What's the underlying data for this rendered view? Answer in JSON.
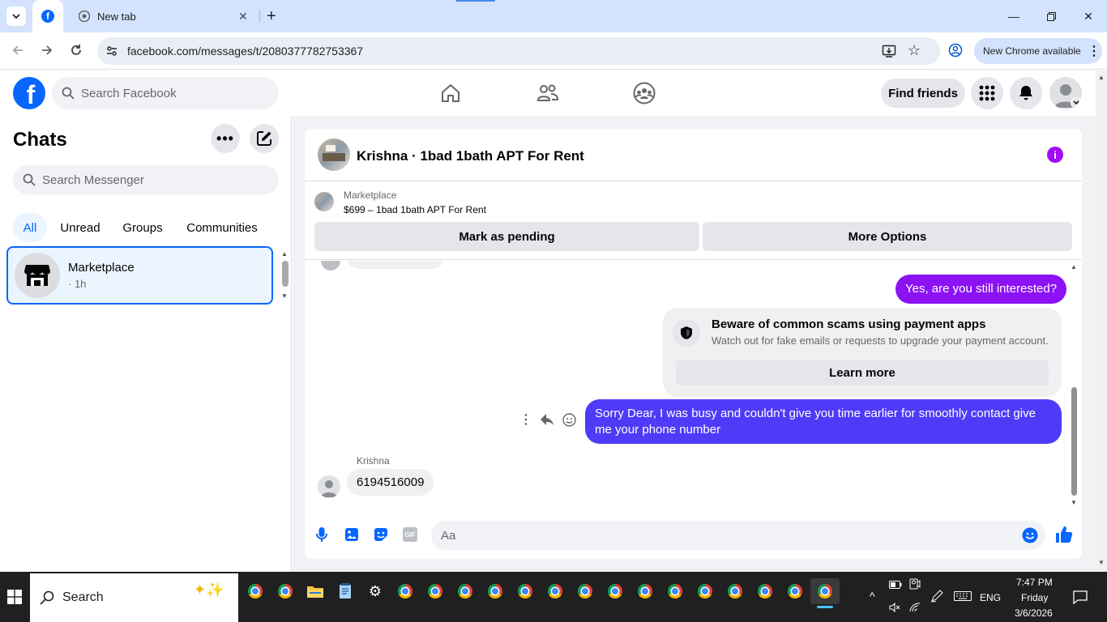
{
  "browser": {
    "tab_title": "New tab",
    "url": "facebook.com/messages/t/2080377782753367",
    "update_label": "New Chrome available"
  },
  "facebook": {
    "search_placeholder": "Search Facebook",
    "find_friends": "Find friends"
  },
  "chats": {
    "title": "Chats",
    "search_placeholder": "Search Messenger",
    "filters": [
      "All",
      "Unread",
      "Groups",
      "Communities"
    ],
    "items": [
      {
        "name": "Marketplace",
        "time": "· 1h"
      }
    ]
  },
  "conversation": {
    "title": "Krishna · 1bad 1bath APT For Rent",
    "marketplace_label": "Marketplace",
    "listing": "$699 – 1bad 1bath APT For Rent",
    "mark_pending": "Mark as pending",
    "more_options": "More Options",
    "messages": {
      "out1": "Yes, are you still interested?",
      "scam_title": "Beware of common scams using payment apps",
      "scam_body": "Watch out for fake emails or requests to upgrade your payment account.",
      "learn_more": "Learn more",
      "out2": "Sorry Dear, I was busy and couldn't give you time earlier for smoothly contact give me your phone number",
      "sender": "Krishna",
      "in1": "6194516009"
    },
    "composer_placeholder": "Aa"
  },
  "taskbar": {
    "search_label": "Search",
    "lang": "ENG",
    "time": "7:47 PM",
    "day": "Friday",
    "date": "3/6/2026"
  },
  "colors": {
    "fb_blue": "#0866ff",
    "bubble_purple": "#7a16ff",
    "bubble_blue": "#4f3bf7",
    "info_purple": "#a30cf0"
  }
}
